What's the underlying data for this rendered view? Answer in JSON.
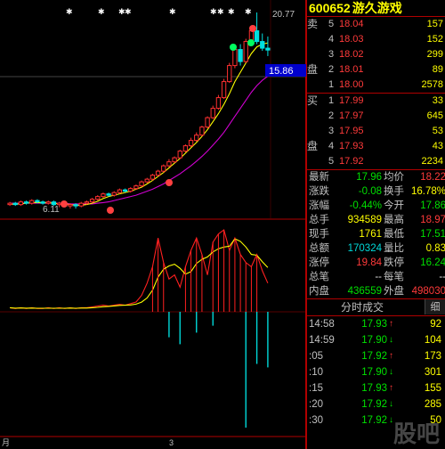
{
  "stock": {
    "code": "600652",
    "name": "游久游戏"
  },
  "chart": {
    "high_label": "20.77",
    "price_tag": "15.86",
    "low_label": "6.11",
    "x_labels": [
      "月",
      "3"
    ]
  },
  "order_book": {
    "sell_label_1": "卖",
    "sell_label_2": "盘",
    "buy_label_1": "买",
    "buy_label_2": "盘",
    "sell": [
      {
        "level": "5",
        "price": "18.04",
        "vol": "157"
      },
      {
        "level": "4",
        "price": "18.03",
        "vol": "152"
      },
      {
        "level": "3",
        "price": "18.02",
        "vol": "299"
      },
      {
        "level": "2",
        "price": "18.01",
        "vol": "89"
      },
      {
        "level": "1",
        "price": "18.00",
        "vol": "2578"
      }
    ],
    "buy": [
      {
        "level": "1",
        "price": "17.99",
        "vol": "33"
      },
      {
        "level": "2",
        "price": "17.97",
        "vol": "645"
      },
      {
        "level": "3",
        "price": "17.95",
        "vol": "53"
      },
      {
        "level": "4",
        "price": "17.93",
        "vol": "43"
      },
      {
        "level": "5",
        "price": "17.92",
        "vol": "2234"
      }
    ]
  },
  "stats": [
    {
      "k1": "最新",
      "v1": "17.96",
      "c1": "grn",
      "k2": "均价",
      "v2": "18.22",
      "c2": "red"
    },
    {
      "k1": "涨跌",
      "v1": "-0.08",
      "c1": "grn",
      "k2": "换手",
      "v2": "16.78%",
      "c2": "yel"
    },
    {
      "k1": "涨幅",
      "v1": "-0.44%",
      "c1": "grn",
      "k2": "今开",
      "v2": "17.86",
      "c2": "grn"
    },
    {
      "k1": "总手",
      "v1": "934589",
      "c1": "yel",
      "k2": "最高",
      "v2": "18.97",
      "c2": "red"
    },
    {
      "k1": "现手",
      "v1": "1761",
      "c1": "yel",
      "k2": "最低",
      "v2": "17.51",
      "c2": "grn"
    },
    {
      "k1": "总额",
      "v1": "170324",
      "c1": "cyan",
      "k2": "量比",
      "v2": "0.83",
      "c2": "yel"
    },
    {
      "k1": "涨停",
      "v1": "19.84",
      "c1": "red",
      "k2": "跌停",
      "v2": "16.24",
      "c2": "grn"
    },
    {
      "k1": "总笔",
      "v1": "--",
      "c1": "wht",
      "k2": "每笔",
      "v2": "--",
      "c2": "wht"
    },
    {
      "k1": "内盘",
      "v1": "436559",
      "c1": "grn",
      "k2": "外盘",
      "v2": "498030",
      "c2": "red"
    }
  ],
  "ticker": {
    "title": "分时成交",
    "button": "细",
    "rows": [
      {
        "time": "14:58",
        "price": "17.93",
        "pc": "grn",
        "arrow": "↑",
        "ac": "red",
        "vol": "92"
      },
      {
        "time": "14:59",
        "price": "17.90",
        "pc": "grn",
        "arrow": "↓",
        "ac": "grn",
        "vol": "104"
      },
      {
        "time": ":05",
        "price": "17.92",
        "pc": "grn",
        "arrow": "↑",
        "ac": "red",
        "vol": "173"
      },
      {
        "time": ":10",
        "price": "17.90",
        "pc": "grn",
        "arrow": "↓",
        "ac": "grn",
        "vol": "301"
      },
      {
        "time": ":15",
        "price": "17.93",
        "pc": "grn",
        "arrow": "↑",
        "ac": "red",
        "vol": "155"
      },
      {
        "time": ":20",
        "price": "17.92",
        "pc": "grn",
        "arrow": "↓",
        "ac": "grn",
        "vol": "285"
      },
      {
        "time": ":30",
        "price": "17.92",
        "pc": "grn",
        "arrow": "↓",
        "ac": "grn",
        "vol": "50"
      }
    ]
  },
  "watermark": {
    "logo": "股吧",
    "url": "guba"
  },
  "chart_data": {
    "type": "candlestick",
    "ylim": [
      6.11,
      20.77
    ],
    "candles": [
      [
        6.4,
        6.5,
        6.3,
        6.6
      ],
      [
        6.5,
        6.4,
        6.3,
        6.6
      ],
      [
        6.4,
        6.6,
        6.3,
        6.7
      ],
      [
        6.6,
        6.5,
        6.4,
        6.7
      ],
      [
        6.5,
        6.7,
        6.4,
        6.8
      ],
      [
        6.7,
        6.6,
        6.5,
        6.8
      ],
      [
        6.6,
        6.5,
        6.4,
        6.7
      ],
      [
        6.5,
        6.6,
        6.4,
        6.7
      ],
      [
        6.6,
        6.4,
        6.3,
        6.7
      ],
      [
        6.4,
        6.5,
        6.2,
        6.6
      ],
      [
        6.5,
        6.3,
        6.2,
        6.6
      ],
      [
        6.3,
        6.4,
        6.1,
        6.5
      ],
      [
        6.4,
        6.3,
        6.1,
        6.5
      ],
      [
        6.3,
        6.5,
        6.2,
        6.6
      ],
      [
        6.5,
        6.6,
        6.4,
        6.7
      ],
      [
        6.6,
        6.8,
        6.5,
        6.9
      ],
      [
        6.8,
        7.0,
        6.7,
        7.1
      ],
      [
        7.0,
        7.2,
        6.9,
        7.3
      ],
      [
        7.2,
        7.1,
        7.0,
        7.3
      ],
      [
        7.1,
        7.3,
        7.0,
        7.4
      ],
      [
        7.3,
        7.5,
        7.2,
        7.6
      ],
      [
        7.5,
        7.4,
        7.3,
        7.6
      ],
      [
        7.4,
        7.6,
        7.3,
        7.7
      ],
      [
        7.6,
        7.8,
        7.5,
        7.9
      ],
      [
        7.8,
        8.1,
        7.7,
        8.2
      ],
      [
        8.1,
        8.3,
        8.0,
        8.4
      ],
      [
        8.3,
        8.6,
        8.2,
        8.7
      ],
      [
        8.6,
        8.9,
        8.5,
        9.0
      ],
      [
        8.9,
        9.3,
        8.8,
        9.4
      ],
      [
        9.3,
        9.6,
        9.2,
        9.8
      ],
      [
        9.6,
        9.9,
        9.5,
        10.0
      ],
      [
        9.9,
        10.4,
        9.8,
        10.5
      ],
      [
        10.4,
        10.8,
        10.3,
        10.9
      ],
      [
        10.8,
        11.2,
        10.7,
        11.4
      ],
      [
        11.2,
        11.6,
        11.1,
        11.8
      ],
      [
        11.6,
        12.2,
        11.5,
        12.3
      ],
      [
        12.2,
        12.9,
        12.1,
        13.0
      ],
      [
        12.9,
        13.6,
        12.8,
        13.8
      ],
      [
        13.6,
        14.4,
        13.5,
        14.6
      ],
      [
        14.4,
        15.6,
        14.3,
        15.8
      ],
      [
        15.6,
        16.8,
        15.5,
        17.0
      ],
      [
        16.8,
        18.0,
        16.6,
        18.4
      ],
      [
        18.0,
        17.1,
        16.8,
        18.4
      ],
      [
        17.1,
        18.6,
        17.0,
        18.8
      ],
      [
        18.6,
        19.4,
        18.5,
        19.6
      ],
      [
        19.4,
        18.6,
        18.4,
        20.77
      ],
      [
        18.6,
        18.1,
        17.9,
        19.2
      ],
      [
        18.1,
        17.96,
        17.51,
        18.97
      ]
    ],
    "ma_short": [
      6.4,
      6.45,
      6.45,
      6.5,
      6.55,
      6.55,
      6.55,
      6.55,
      6.5,
      6.45,
      6.45,
      6.4,
      6.35,
      6.35,
      6.4,
      6.5,
      6.65,
      6.85,
      7.0,
      7.1,
      7.2,
      7.3,
      7.4,
      7.55,
      7.7,
      7.95,
      8.2,
      8.5,
      8.8,
      9.15,
      9.5,
      9.85,
      10.25,
      10.65,
      11.05,
      11.5,
      12.0,
      12.6,
      13.2,
      13.9,
      14.7,
      15.6,
      16.3,
      17.0,
      17.7,
      18.2,
      18.4,
      18.5
    ],
    "ma_long": [
      6.5,
      6.5,
      6.5,
      6.5,
      6.5,
      6.5,
      6.5,
      6.5,
      6.5,
      6.5,
      6.5,
      6.45,
      6.45,
      6.45,
      6.45,
      6.45,
      6.5,
      6.55,
      6.6,
      6.7,
      6.8,
      6.9,
      7.0,
      7.1,
      7.25,
      7.4,
      7.55,
      7.75,
      7.95,
      8.2,
      8.45,
      8.7,
      9.0,
      9.3,
      9.65,
      10.0,
      10.4,
      10.85,
      11.3,
      11.8,
      12.4,
      13.0,
      13.6,
      14.2,
      14.8,
      15.3,
      15.7,
      16.0
    ],
    "volume": [
      0.05,
      0.04,
      0.05,
      0.04,
      0.05,
      0.04,
      0.04,
      0.05,
      0.04,
      0.05,
      0.04,
      0.05,
      0.04,
      0.05,
      0.05,
      0.06,
      0.07,
      0.08,
      0.07,
      0.08,
      0.09,
      0.08,
      0.1,
      0.12,
      0.2,
      0.35,
      0.55,
      0.9,
      0.6,
      0.4,
      0.45,
      0.3,
      0.55,
      0.75,
      0.9,
      0.7,
      0.45,
      0.85,
      0.95,
      1.0,
      0.75,
      0.9,
      0.7,
      0.6,
      0.55,
      0.7,
      0.5,
      0.35
    ],
    "macd_bars": [
      0,
      0,
      0,
      0,
      0,
      0,
      0,
      0,
      0,
      0,
      0,
      0,
      0,
      0,
      0,
      0,
      0,
      0,
      0,
      0,
      0,
      0,
      0,
      0,
      0,
      0,
      0,
      0,
      0,
      -0.22,
      0,
      -0.28,
      0,
      0,
      -0.18,
      0,
      0,
      -0.12,
      0,
      0,
      0,
      0,
      0,
      -1.0,
      0,
      -0.45,
      0,
      -0.48
    ]
  }
}
